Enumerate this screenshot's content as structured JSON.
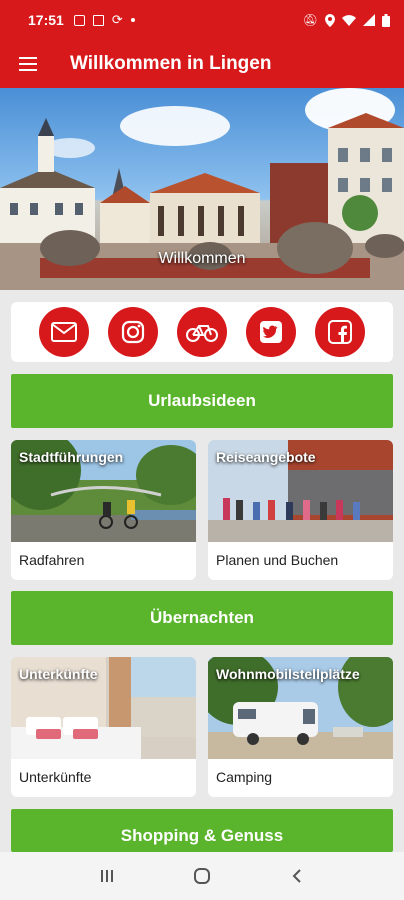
{
  "status_bar": {
    "time": "17:51",
    "left_icons": [
      "image-icon",
      "sim-icon",
      "sync-icon",
      "dot-icon"
    ],
    "right_icons": [
      "mute-icon",
      "location-icon",
      "wifi-icon",
      "signal-icon",
      "battery-icon"
    ]
  },
  "app_bar": {
    "title": "Willkommen in Lingen",
    "menu_icon": "menu-icon"
  },
  "hero": {
    "caption": "Willkommen"
  },
  "social": {
    "items": [
      "mail-icon",
      "instagram-icon",
      "bike-icon",
      "twitter-icon",
      "facebook-icon"
    ]
  },
  "sections": [
    {
      "title": "Urlaubsideen",
      "cards": [
        {
          "overlay": "Stadtführungen",
          "label": "Radfahren"
        },
        {
          "overlay": "Reiseangebote",
          "label": "Planen und Buchen"
        }
      ]
    },
    {
      "title": "Übernachten",
      "cards": [
        {
          "overlay": "Unterkünfte",
          "label": "Unterkünfte"
        },
        {
          "overlay": "Wohnmobilstellplätze",
          "label": "Camping"
        }
      ]
    },
    {
      "title": "Shopping & Genuss"
    }
  ],
  "nav_bar": {
    "items": [
      "recent-apps-icon",
      "home-icon",
      "back-icon"
    ]
  },
  "colors": {
    "primary_red": "#d7191c",
    "green": "#5ab52d",
    "background": "#e9e9e9"
  }
}
